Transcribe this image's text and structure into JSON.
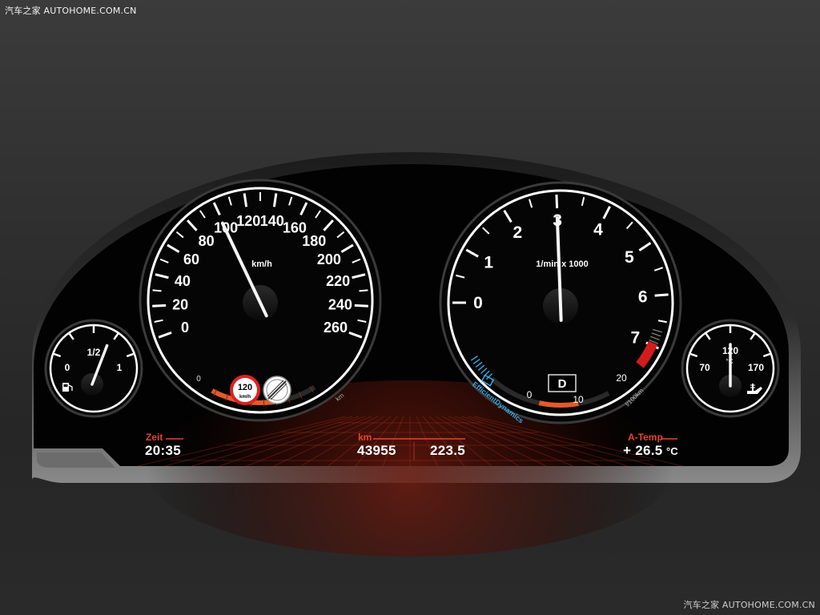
{
  "watermark": {
    "top": "汽车之家  AUTOHOME.COM.CN",
    "bottom": "汽车之家  AUTOHOME.COM.CN"
  },
  "speedometer": {
    "unit": "km/h",
    "scale": [
      0,
      20,
      40,
      60,
      80,
      100,
      120,
      140,
      160,
      180,
      200,
      220,
      240,
      260
    ],
    "needle_value": 100,
    "sub_label_zero": "0",
    "sub_label_unit": "km",
    "speed_limit_value": "120",
    "speed_limit_unit": "km/h"
  },
  "tachometer": {
    "unit": "1/min x 1000",
    "scale": [
      0,
      1,
      2,
      3,
      4,
      5,
      6,
      7
    ],
    "needle_value": 3,
    "redline_from": 6.7,
    "gear": "D",
    "eco_label": "EfficientDynamics",
    "consumption_labels": [
      "0",
      "10",
      "20"
    ],
    "consumption_unit": "l/100km"
  },
  "fuel_gauge": {
    "labels": [
      "0",
      "1/2",
      "1"
    ],
    "icon": "fuel-pump-icon",
    "level_fraction": 0.65
  },
  "oil_temp_gauge": {
    "labels": [
      "70",
      "120",
      "170"
    ],
    "unit": "°C",
    "needle_value": 120,
    "icon": "oil-can-icon"
  },
  "info": {
    "time_label": "Zeit",
    "time_value": "20:35",
    "km_label": "km",
    "odometer": "43955",
    "trip": "223.5",
    "temp_label": "A-Temp",
    "temp_value": "+ 26.5",
    "temp_unit": "°C"
  },
  "colors": {
    "accent_red": "#e8432f",
    "orange_bar": "#e45a2a",
    "eco_blue": "#38a8e0"
  }
}
